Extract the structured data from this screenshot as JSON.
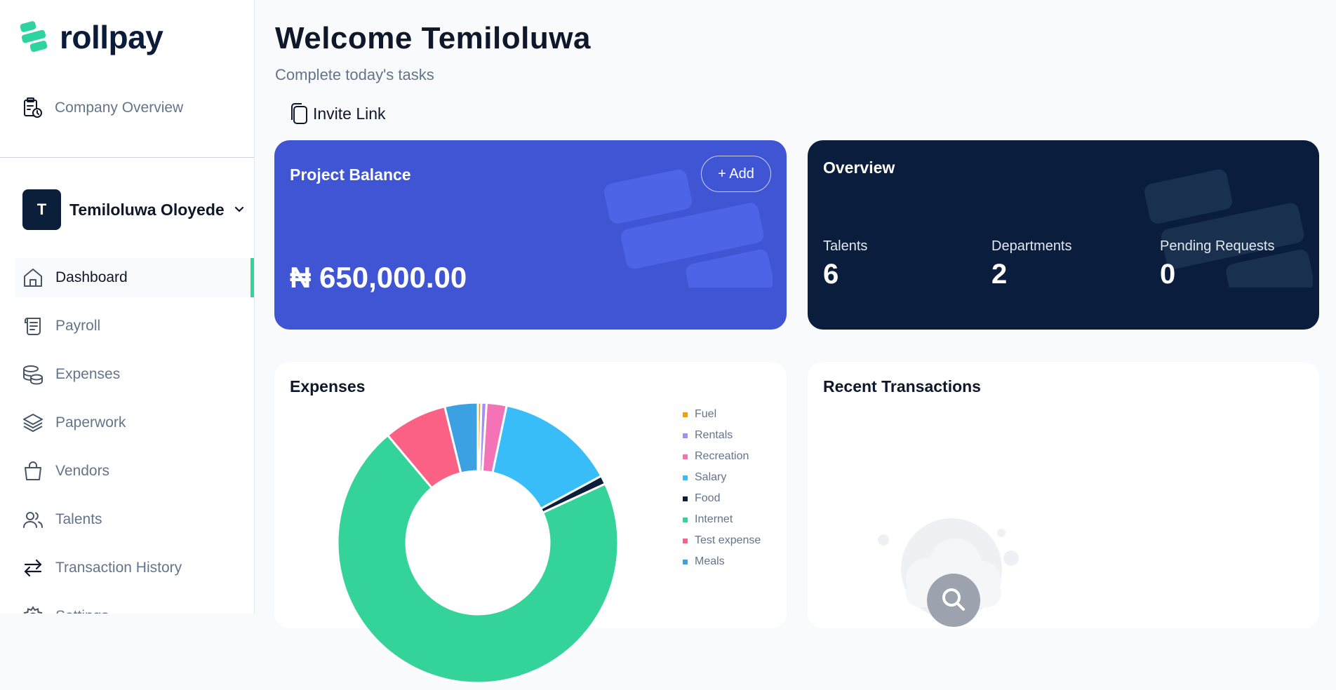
{
  "brand": {
    "name": "rollpay",
    "accent": "#34d399"
  },
  "sidebar": {
    "company_overview": {
      "label": "Company Overview",
      "icon": "clipboard-clock-icon"
    },
    "user": {
      "initial": "T",
      "name": "Temiloluwa Oloyede"
    },
    "nav": [
      {
        "label": "Dashboard",
        "icon": "home-icon",
        "active": true
      },
      {
        "label": "Payroll",
        "icon": "scroll-icon"
      },
      {
        "label": "Expenses",
        "icon": "coins-icon"
      },
      {
        "label": "Paperwork",
        "icon": "layers-icon"
      },
      {
        "label": "Vendors",
        "icon": "shopping-bag-icon"
      },
      {
        "label": "Talents",
        "icon": "users-icon"
      },
      {
        "label": "Transaction History",
        "icon": "arrows-swap-icon"
      },
      {
        "label": "Settings",
        "icon": "gear-icon"
      }
    ]
  },
  "header": {
    "title": "Welcome Temiloluwa",
    "subtitle": "Complete today's tasks",
    "invite_label": "Invite Link"
  },
  "balance_card": {
    "title": "Project Balance",
    "add_label": "+ Add",
    "amount": "₦ 650,000.00",
    "bg_color": "#3f55d4"
  },
  "overview_card": {
    "title": "Overview",
    "bg_color": "#0a1d3c",
    "stats": [
      {
        "label": "Talents",
        "value": "6"
      },
      {
        "label": "Departments",
        "value": "2"
      },
      {
        "label": "Pending Requests",
        "value": "0"
      }
    ]
  },
  "expenses_panel": {
    "title": "Expenses"
  },
  "transactions_panel": {
    "title": "Recent Transactions"
  },
  "chart_data": {
    "type": "pie",
    "title": "Expenses",
    "legend_position": "right",
    "series": [
      {
        "name": "Fuel",
        "value": 0.4,
        "color": "#f59e0b"
      },
      {
        "name": "Rentals",
        "value": 0.6,
        "color": "#a78bfa"
      },
      {
        "name": "Recreation",
        "value": 2.3,
        "color": "#f472b6"
      },
      {
        "name": "Salary",
        "value": 13.8,
        "color": "#38bdf8"
      },
      {
        "name": "Food",
        "value": 1.0,
        "color": "#0b1f3b"
      },
      {
        "name": "Internet",
        "value": 70.8,
        "color": "#34d399"
      },
      {
        "name": "Test expense",
        "value": 7.3,
        "color": "#fb6185"
      },
      {
        "name": "Meals",
        "value": 3.8,
        "color": "#3ba1e3"
      }
    ]
  }
}
